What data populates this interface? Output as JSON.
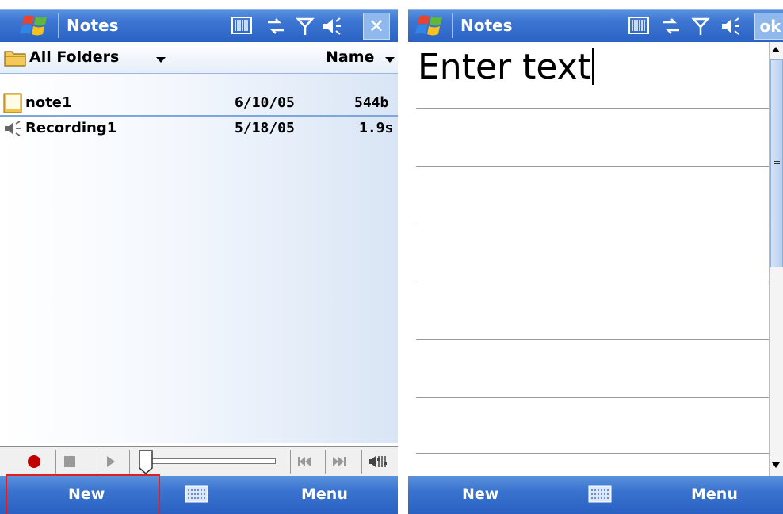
{
  "left": {
    "app_title": "Notes",
    "close_label": "✕",
    "header": {
      "folder_label": "All Folders",
      "sort_label": "Name"
    },
    "files": [
      {
        "name": "note1",
        "date": "6/10/05",
        "size": "544b",
        "icon": "note-icon"
      },
      {
        "name": "Recording1",
        "date": "5/18/05",
        "size": "1.9s",
        "icon": "speaker-icon"
      }
    ],
    "softkeys": {
      "left": "New",
      "right": "Menu"
    }
  },
  "right": {
    "app_title": "Notes",
    "ok_label": "ok",
    "note_text": "Enter text",
    "softkeys": {
      "left": "New",
      "right": "Menu"
    }
  },
  "colors": {
    "titlebar": "#3d76d2",
    "softbar": "#3a73cf",
    "highlight": "#e02020",
    "record": "#c00000"
  }
}
